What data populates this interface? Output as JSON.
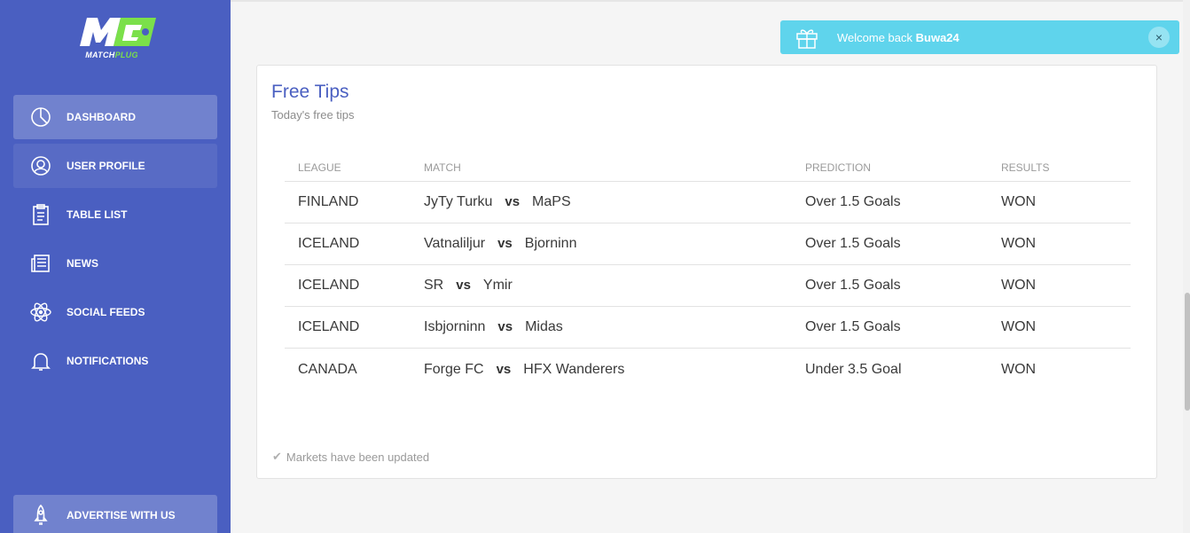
{
  "brand": {
    "logo_mark": "M",
    "name_part1": "MATCH",
    "name_part2": "PLUG"
  },
  "sidebar": {
    "items": [
      {
        "label": "DASHBOARD",
        "icon": "pie-chart-icon",
        "active": true
      },
      {
        "label": "USER PROFILE",
        "icon": "user-icon",
        "active": false
      },
      {
        "label": "TABLE LIST",
        "icon": "clipboard-icon",
        "active": false
      },
      {
        "label": "NEWS",
        "icon": "newspaper-icon",
        "active": false
      },
      {
        "label": "SOCIAL FEEDS",
        "icon": "atom-icon",
        "active": false
      },
      {
        "label": "NOTIFICATIONS",
        "icon": "bell-icon",
        "active": false
      }
    ],
    "advertise": {
      "label": "ADVERTISE WITH US",
      "icon": "rocket-icon"
    }
  },
  "toast": {
    "prefix": "Welcome back ",
    "username": "Buwa24",
    "close": "×"
  },
  "card": {
    "title": "Free Tips",
    "subtitle": "Today's free tips",
    "columns": [
      "LEAGUE",
      "MATCH",
      "PREDICTION",
      "RESULTS"
    ],
    "vs_label": "vs",
    "rows": [
      {
        "league": "FINLAND",
        "home": "JyTy Turku",
        "away": "MaPS",
        "prediction": "Over 1.5 Goals",
        "result": "WON"
      },
      {
        "league": "ICELAND",
        "home": "Vatnaliljur",
        "away": "Bjorninn",
        "prediction": "Over 1.5 Goals",
        "result": "WON"
      },
      {
        "league": "ICELAND",
        "home": "SR",
        "away": "Ymir",
        "prediction": "Over 1.5 Goals",
        "result": "WON"
      },
      {
        "league": "ICELAND",
        "home": "Isbjorninn",
        "away": "Midas",
        "prediction": "Over 1.5 Goals",
        "result": "WON"
      },
      {
        "league": "CANADA",
        "home": "Forge FC",
        "away": "HFX Wanderers",
        "prediction": "Under 3.5 Goal",
        "result": "WON"
      }
    ],
    "footer": "Markets have been updated"
  },
  "colors": {
    "sidebar": "#4a5fc1",
    "toast": "#5fd4ec",
    "title": "#4a5fc1",
    "logo_accent": "#7be04a"
  }
}
